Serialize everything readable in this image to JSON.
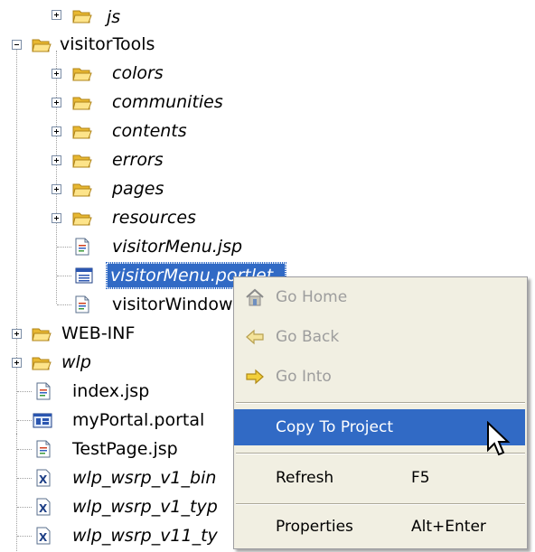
{
  "tree": {
    "js": "js",
    "visitorTools": "visitorTools",
    "colors": "colors",
    "communities": "communities",
    "contents": "contents",
    "errors": "errors",
    "pages": "pages",
    "resources": "resources",
    "visitorMenuJsp": "visitorMenu.jsp",
    "visitorMenuPortlet": "visitorMenu.portlet",
    "visitorWindow": "visitorWindow",
    "webinf": "WEB-INF",
    "wlp": "wlp",
    "indexJsp": "index.jsp",
    "myPortal": "myPortal.portal",
    "testPage": "TestPage.jsp",
    "wsrpBin": "wlp_wsrp_v1_bin",
    "wsrpTyp": "wlp_wsrp_v1_typ",
    "wsrpV11": "wlp_wsrp_v11_ty"
  },
  "menu": {
    "goHome": "Go Home",
    "goBack": "Go Back",
    "goInto": "Go Into",
    "copyToProject": "Copy To Project",
    "refresh": "Refresh",
    "refreshKey": "F5",
    "properties": "Properties",
    "propertiesKey": "Alt+Enter"
  },
  "colors": {
    "selection": "#316ac5",
    "menuBg": "#f1efe2",
    "folder": "#f4cf5e",
    "disabledText": "#9d9d9d"
  }
}
